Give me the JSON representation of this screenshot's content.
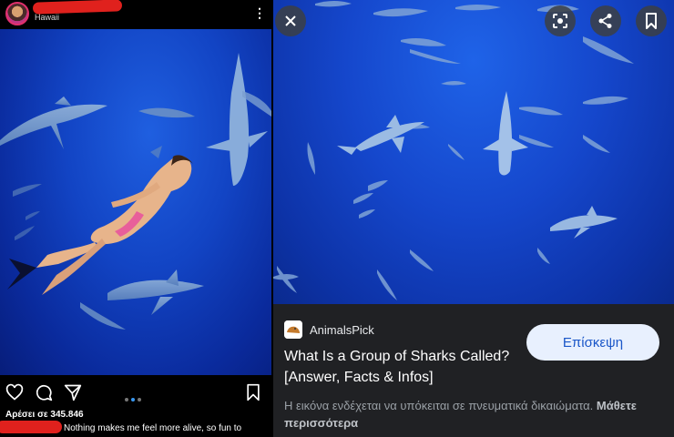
{
  "instagram": {
    "location": "Hawaii",
    "likes": "Αρέσει σε 345.846",
    "caption": "Nothing makes me feel more alive, so fun to",
    "more_icon": "kebab-menu-icon",
    "icons": [
      "heart-icon",
      "comment-icon",
      "share-icon",
      "bookmark-icon"
    ]
  },
  "lens": {
    "source_name": "AnimalsPick",
    "title": "What Is a Group of Sharks Called? [Answer, Facts & Infos]",
    "visit_label": "Επίσκεψη",
    "copyright_text": "Η εικόνα ενδέχεται να υπόκειται σε πνευματικά δικαιώματα.",
    "learn_more": "Μάθετε περισσότερα",
    "icons": [
      "close-icon",
      "lens-icon",
      "share-icon",
      "bookmark-icon"
    ]
  },
  "colors": {
    "accent_blue": "#3897f0",
    "redaction": "#e0211d",
    "visit_button_bg": "#e8f0fe",
    "visit_button_text": "#1a56c8"
  }
}
